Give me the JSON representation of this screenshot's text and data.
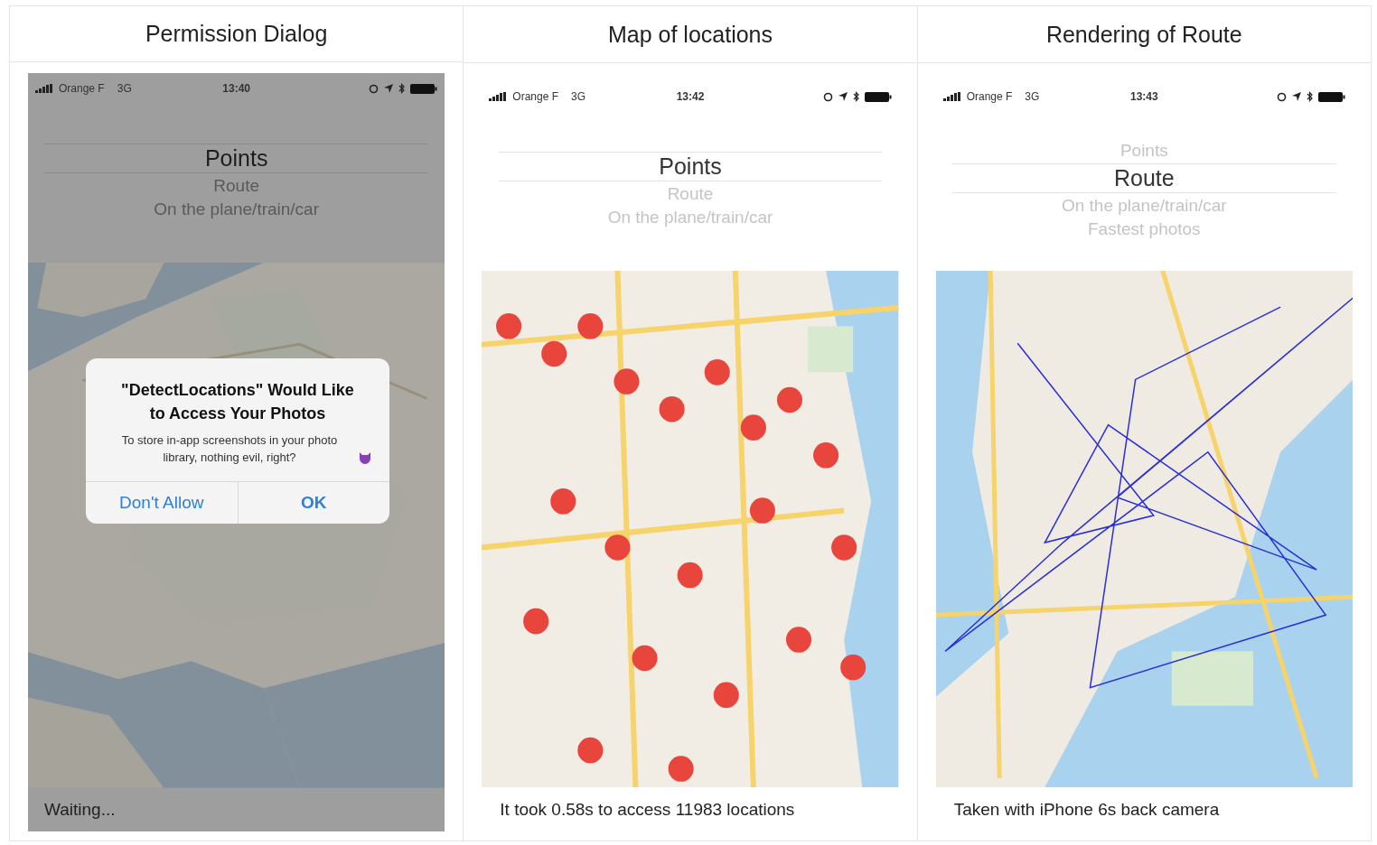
{
  "panels": [
    {
      "title": "Permission Dialog",
      "screen": {
        "dimmed": true,
        "status": {
          "carrier": "Orange F",
          "network": "3G",
          "time": "13:40"
        },
        "picker": [
          {
            "label": "Points",
            "selected": true
          },
          {
            "label": "Route",
            "selected": false
          },
          {
            "label": "On the plane/train/car",
            "selected": false
          }
        ],
        "map": {
          "kind": "regions"
        },
        "dialog": {
          "title": "\"DetectLocations\" Would Like to Access Your Photos",
          "message": "To store in-app screenshots in your photo library, nothing evil, right?",
          "buttons": [
            {
              "label": "Don't Allow",
              "bold": false
            },
            {
              "label": "OK",
              "bold": true
            }
          ]
        },
        "footer": "Waiting..."
      }
    },
    {
      "title": "Map of locations",
      "screen": {
        "dimmed": false,
        "status": {
          "carrier": "Orange F",
          "network": "3G",
          "time": "13:42"
        },
        "picker": [
          {
            "label": "Points",
            "selected": true
          },
          {
            "label": "Route",
            "selected": false
          },
          {
            "label": "On the plane/train/car",
            "selected": false
          }
        ],
        "map": {
          "kind": "pins"
        },
        "caption": "It took 0.58s to access 11983 locations"
      }
    },
    {
      "title": "Rendering of Route",
      "screen": {
        "dimmed": false,
        "status": {
          "carrier": "Orange F",
          "network": "3G",
          "time": "13:43"
        },
        "picker": [
          {
            "label": "Points",
            "selected": false
          },
          {
            "label": "Route",
            "selected": true
          },
          {
            "label": "On the plane/train/car",
            "selected": false
          },
          {
            "label": "Fastest photos",
            "selected": false
          }
        ],
        "map": {
          "kind": "route"
        },
        "caption": "Taken with iPhone 6s back camera"
      }
    }
  ]
}
